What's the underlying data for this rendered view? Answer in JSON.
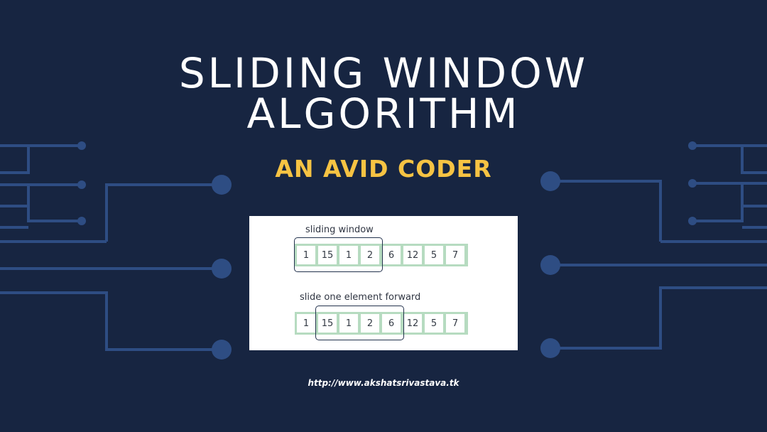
{
  "title": {
    "line1": "SLIDING WINDOW",
    "line2": "ALGORITHM"
  },
  "subtitle": "AN AVID CODER",
  "diagram": {
    "rows": [
      {
        "label": "sliding window",
        "values": [
          "1",
          "15",
          "1",
          "2",
          "6",
          "12",
          "5",
          "7"
        ],
        "window_start_index": 0,
        "window_size": 4
      },
      {
        "label": "slide one element forward",
        "values": [
          "1",
          "15",
          "1",
          "2",
          "6",
          "12",
          "5",
          "7"
        ],
        "window_start_index": 1,
        "window_size": 4
      }
    ]
  },
  "footer": {
    "url": "http://www.akshatsrivastava.tk"
  },
  "colors": {
    "background": "#172541",
    "circuit": "#2e4d83",
    "title": "#ffffff",
    "subtitle": "#f6c343",
    "cell_border": "#b6dbc0",
    "window_outline": "#23324d"
  }
}
